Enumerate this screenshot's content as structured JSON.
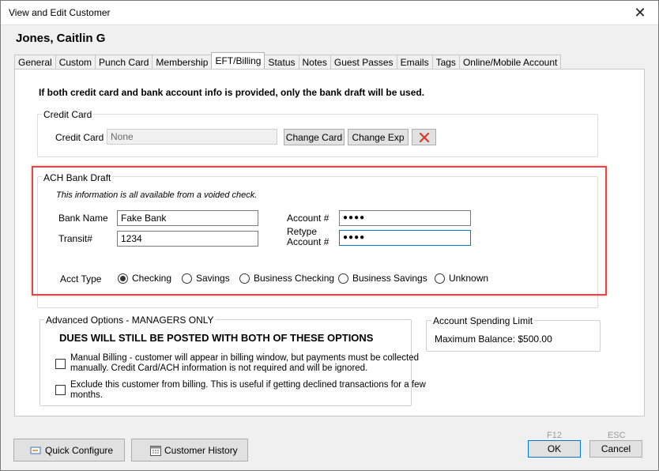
{
  "window": {
    "title": "View and Edit Customer",
    "close_glyph": "✕"
  },
  "customer": {
    "name": "Jones, Caitlin G"
  },
  "tabs": [
    {
      "label": "General"
    },
    {
      "label": "Custom"
    },
    {
      "label": "Punch Card"
    },
    {
      "label": "Membership"
    },
    {
      "label": "EFT/Billing"
    },
    {
      "label": "Status"
    },
    {
      "label": "Notes"
    },
    {
      "label": "Guest Passes"
    },
    {
      "label": "Emails"
    },
    {
      "label": "Tags"
    },
    {
      "label": "Online/Mobile Account"
    }
  ],
  "active_tab": "EFT/Billing",
  "notice": "If both credit card and bank account info is provided, only the bank draft will be used.",
  "credit_card": {
    "group_title": "Credit Card",
    "label": "Credit Card",
    "value": "None",
    "change_card_label": "Change Card",
    "change_exp_label": "Change Exp",
    "delete_icon": "red-x-icon"
  },
  "ach": {
    "group_title": "ACH Bank Draft",
    "hint": "This information is all available from a voided check.",
    "bank_name_label": "Bank Name",
    "bank_name_value": "Fake Bank",
    "transit_label": "Transit#",
    "transit_value": "1234",
    "account_label": "Account #",
    "account_value": "●●●●",
    "retype_label_1": "Retype",
    "retype_label_2": "Account #",
    "retype_value": "●●●●",
    "acct_type_label": "Acct Type",
    "acct_types": [
      {
        "label": "Checking",
        "selected": true
      },
      {
        "label": "Savings",
        "selected": false
      },
      {
        "label": "Business Checking",
        "selected": false
      },
      {
        "label": "Business Savings",
        "selected": false
      },
      {
        "label": "Unknown",
        "selected": false
      }
    ],
    "highlight_color": "#e04848"
  },
  "advanced": {
    "group_title": "Advanced Options - MANAGERS ONLY",
    "warning": "DUES WILL STILL BE POSTED WITH BOTH OF THESE OPTIONS",
    "manual_billing_line1": "Manual Billing - customer will appear in billing window, but payments must be collected",
    "manual_billing_line2": "manually. Credit Card/ACH information is not required and will be ignored.",
    "exclude_line1": "Exclude this customer from billing.  This is useful if getting declined transactions for a few",
    "exclude_line2": "months."
  },
  "spending_limit": {
    "group_title": "Account Spending Limit",
    "text": "Maximum Balance: $500.00"
  },
  "footer": {
    "quick_configure_label": "Quick Configure",
    "customer_history_label": "Customer History",
    "ok_hint": "F12",
    "ok_label": "OK",
    "cancel_hint": "ESC",
    "cancel_label": "Cancel"
  }
}
